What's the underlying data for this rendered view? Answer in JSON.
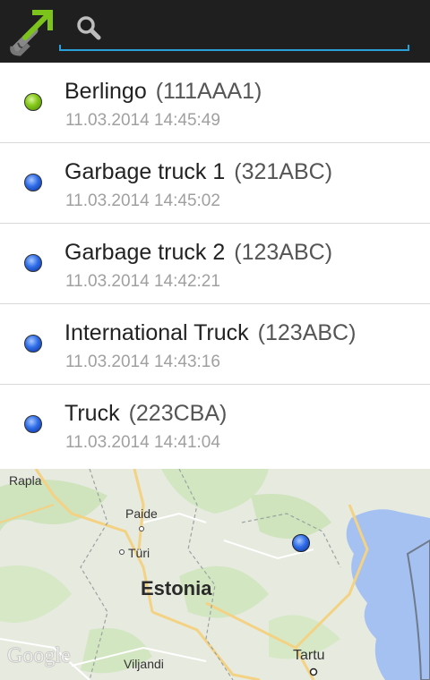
{
  "search": {
    "value": "",
    "placeholder": ""
  },
  "vehicles": [
    {
      "name": "Berlingo",
      "plate": "(111AAA1)",
      "time": "11.03.2014 14:45:49",
      "status": "green"
    },
    {
      "name": "Garbage truck 1",
      "plate": "(321ABC)",
      "time": "11.03.2014 14:45:02",
      "status": "blue"
    },
    {
      "name": "Garbage truck 2",
      "plate": "(123ABC)",
      "time": "11.03.2014 14:42:21",
      "status": "blue"
    },
    {
      "name": "International Truck",
      "plate": "(123ABC)",
      "time": "11.03.2014 14:43:16",
      "status": "blue"
    },
    {
      "name": "Truck",
      "plate": "(223CBA)",
      "time": "11.03.2014 14:41:04",
      "status": "blue"
    }
  ],
  "map": {
    "labels": {
      "rapla": "Rapla",
      "paide": "Paide",
      "turi": "Türi",
      "estonia": "Estonia",
      "tartu": "Tartu",
      "viljandi": "Viljandi"
    },
    "attribution": "Google"
  },
  "colors": {
    "toolbar": "#1f1f1f",
    "accent": "#2aa0d8",
    "status_green": "#8acb1e",
    "status_blue": "#2f6de8"
  }
}
